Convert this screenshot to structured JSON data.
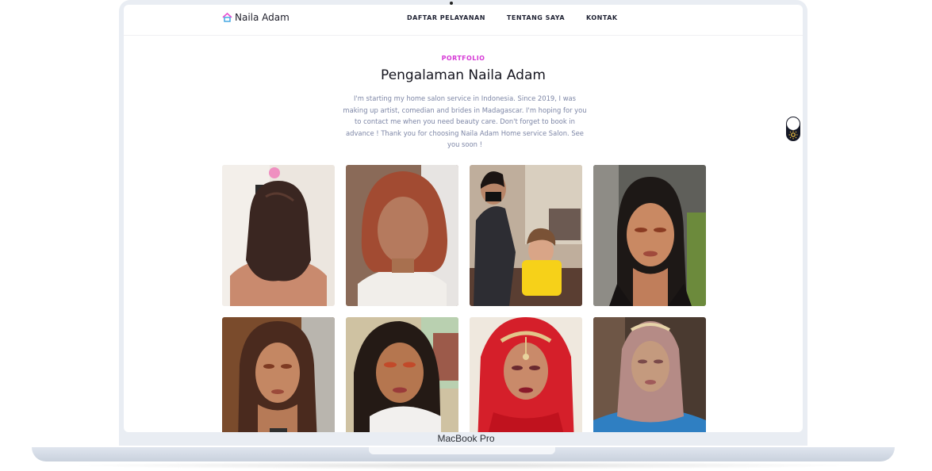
{
  "device": {
    "model_label": "MacBook Pro"
  },
  "brand": {
    "name": "Naila Adam",
    "icon": "house-icon",
    "icon_colors": [
      "#e94cd0",
      "#3aa3e0"
    ]
  },
  "nav": {
    "items": [
      {
        "label": "DAFTAR PELAYANAN"
      },
      {
        "label": "TENTANG SAYA"
      },
      {
        "label": "KONTAK"
      }
    ]
  },
  "section": {
    "eyebrow": "PORTFOLIO",
    "title": "Pengalaman Naila Adam",
    "intro": "I'm starting my home salon service in Indonesia. Since 2019, I was making up artist, comedian and brides in Madagascar. I'm hoping for you to contact me when you need beauty care. Don't forget to book in advance ! Thank you for choosing Naila Adam Home service Salon. See you soon !"
  },
  "theme_toggle": {
    "icon": "sun-icon",
    "state": "light"
  },
  "colors": {
    "accent": "#d63ad6",
    "text_dark": "#15151f",
    "text_muted": "#7d86a6"
  },
  "gallery": {
    "photos": [
      {
        "subject": "back view of woman with shoulder-length brown hair"
      },
      {
        "subject": "selfie of woman with reddish hair"
      },
      {
        "subject": "makeup artist styling a girl's hair"
      },
      {
        "subject": "woman with dark hair and warm eye makeup"
      },
      {
        "subject": "woman with long hair and bronze makeup"
      },
      {
        "subject": "woman with curly hair and glam makeup"
      },
      {
        "subject": "bride in red veil with gold headpiece"
      },
      {
        "subject": "woman in pink hijab with tiara"
      }
    ]
  }
}
